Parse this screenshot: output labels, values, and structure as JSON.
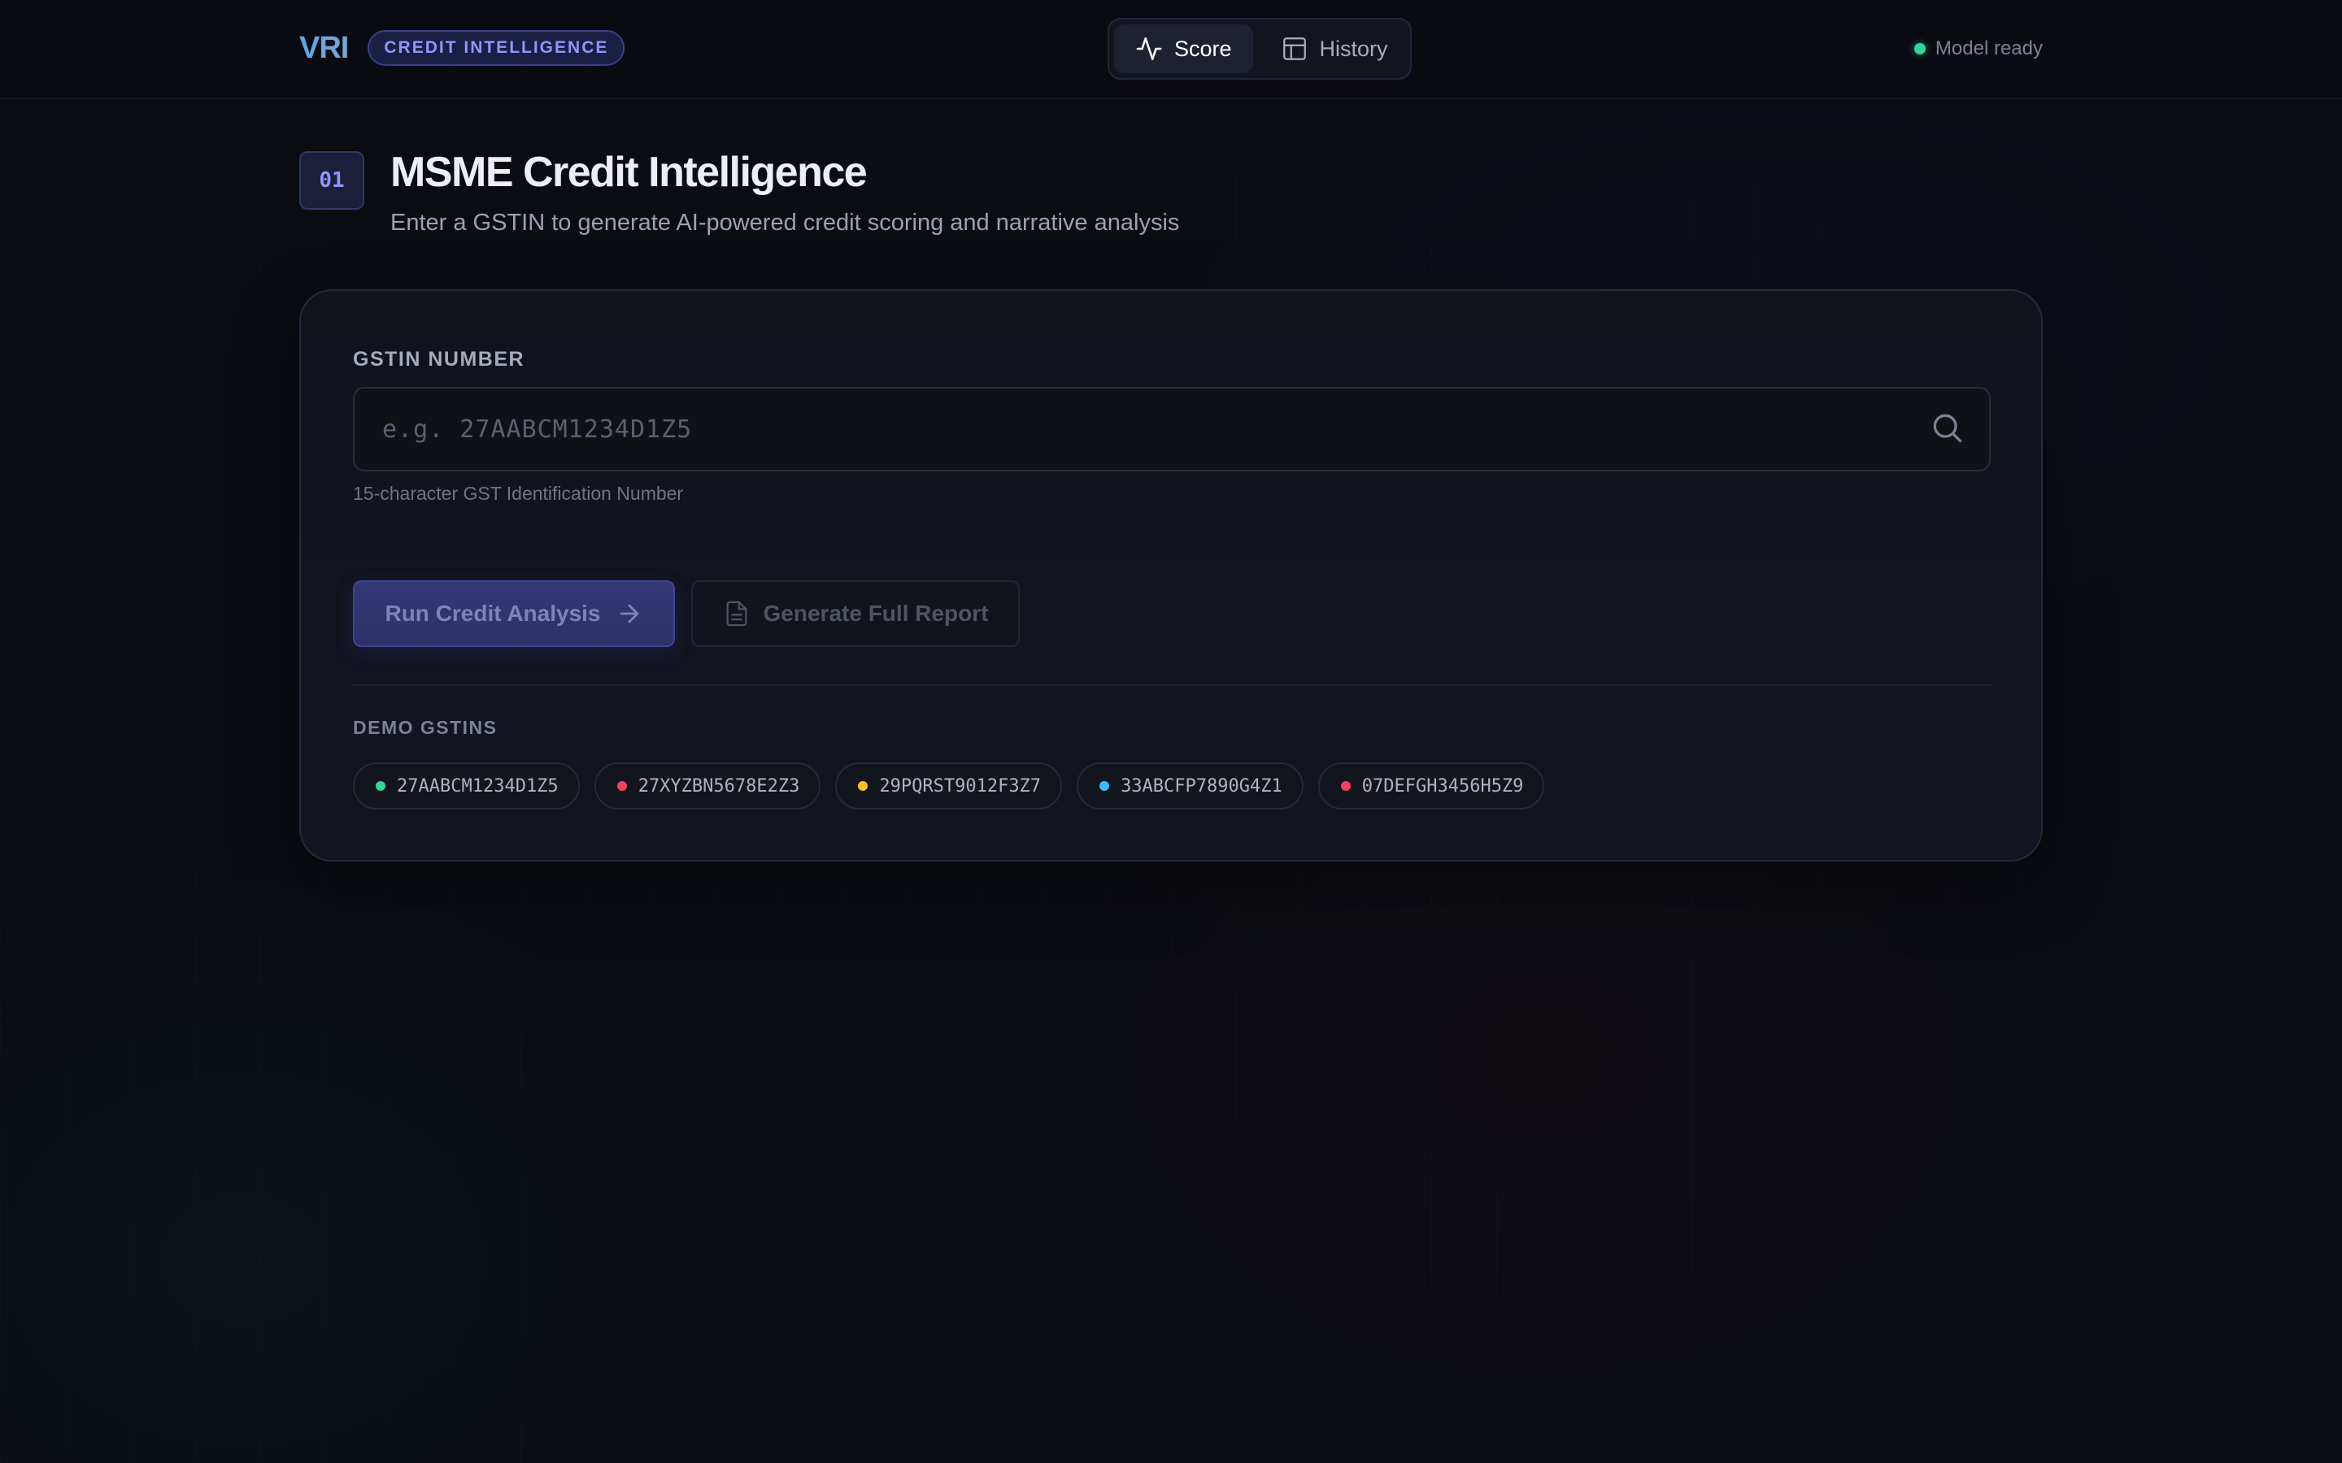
{
  "header": {
    "brand": "VRI",
    "brand_tag": "CREDIT INTELLIGENCE",
    "tabs": [
      {
        "label": "Score",
        "icon": "activity-icon",
        "active": true
      },
      {
        "label": "History",
        "icon": "layout-icon",
        "active": false
      }
    ],
    "status": {
      "label": "Model ready",
      "color": "#34d399"
    }
  },
  "section": {
    "step": "01",
    "title": "MSME Credit Intelligence",
    "subtitle": "Enter a GSTIN to generate AI-powered credit scoring and narrative analysis"
  },
  "form": {
    "label": "GSTIN NUMBER",
    "value": "",
    "placeholder": "e.g. 27AABCM1234D1Z5",
    "helper": "15-character GST Identification Number",
    "primary_button": "Run Credit Analysis",
    "secondary_button": "Generate Full Report"
  },
  "demo": {
    "label": "DEMO GSTINS",
    "items": [
      {
        "gstin": "27AABCM1234D1Z5",
        "color": "#34d399"
      },
      {
        "gstin": "27XYZBN5678E2Z3",
        "color": "#f0445e"
      },
      {
        "gstin": "29PQRST9012F3Z7",
        "color": "#fbbf24"
      },
      {
        "gstin": "33ABCFP7890G4Z1",
        "color": "#38bdf8"
      },
      {
        "gstin": "07DEFGH3456H5Z9",
        "color": "#f43f5e"
      }
    ]
  },
  "colors": {
    "accent": "#8e96ff",
    "background": "#0a0c12"
  }
}
